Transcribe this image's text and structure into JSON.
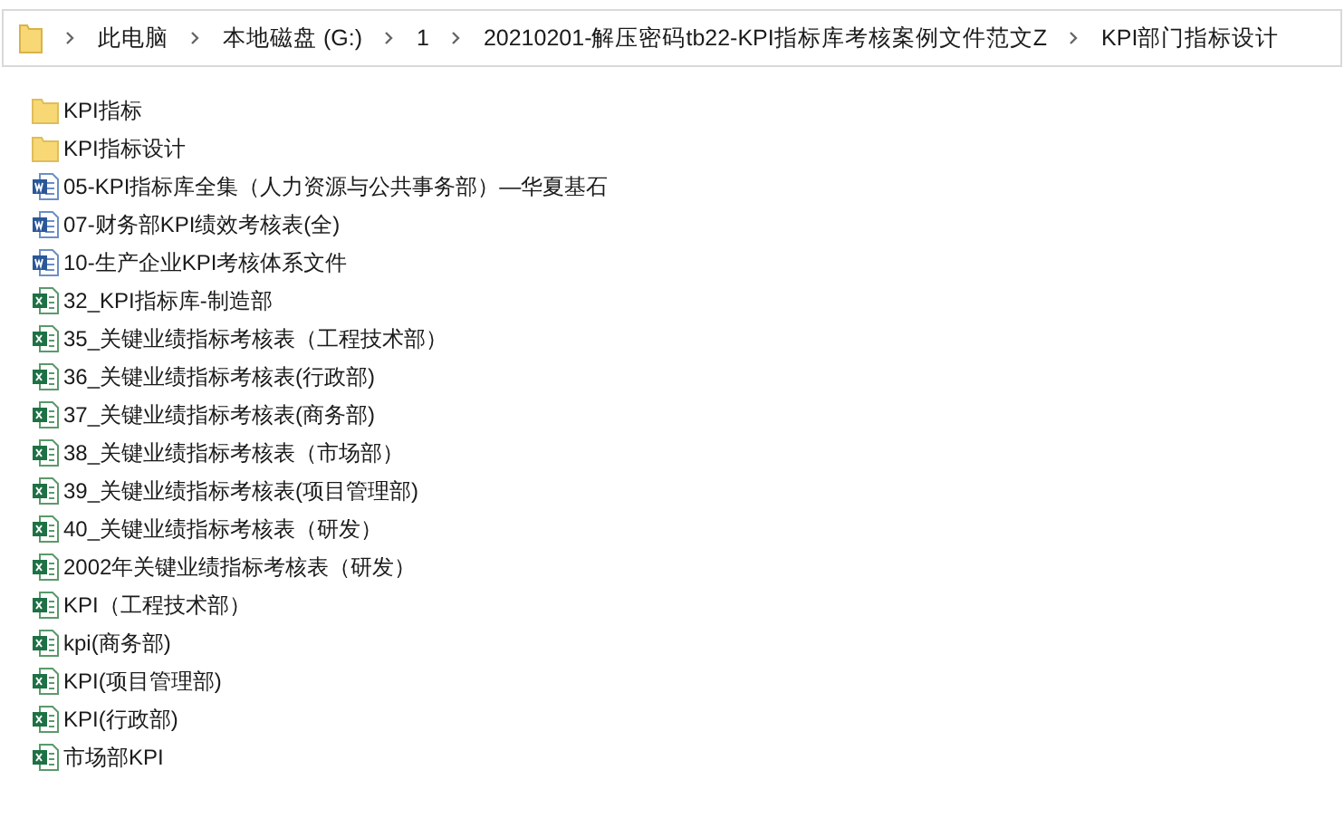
{
  "address_bar": {
    "path": [
      "此电脑",
      "本地磁盘 (G:)",
      "1",
      "20210201-解压密码tb22-KPI指标库考核案例文件范文Z",
      "KPI部门指标设计"
    ]
  },
  "files": [
    {
      "name": "KPI指标",
      "kind": "folder"
    },
    {
      "name": "KPI指标设计",
      "kind": "folder"
    },
    {
      "name": "05-KPI指标库全集（人力资源与公共事务部）—华夏基石",
      "kind": "word"
    },
    {
      "name": "07-财务部KPI绩效考核表(全)",
      "kind": "word"
    },
    {
      "name": "10-生产企业KPI考核体系文件",
      "kind": "word"
    },
    {
      "name": "32_KPI指标库-制造部",
      "kind": "excel"
    },
    {
      "name": "35_关键业绩指标考核表（工程技术部）",
      "kind": "excel"
    },
    {
      "name": "36_关键业绩指标考核表(行政部)",
      "kind": "excel"
    },
    {
      "name": "37_关键业绩指标考核表(商务部)",
      "kind": "excel"
    },
    {
      "name": "38_关键业绩指标考核表（市场部）",
      "kind": "excel"
    },
    {
      "name": "39_关键业绩指标考核表(项目管理部)",
      "kind": "excel"
    },
    {
      "name": "40_关键业绩指标考核表（研发）",
      "kind": "excel"
    },
    {
      "name": "2002年关键业绩指标考核表（研发）",
      "kind": "excel"
    },
    {
      "name": "KPI（工程技术部）",
      "kind": "excel"
    },
    {
      "name": "kpi(商务部)",
      "kind": "excel"
    },
    {
      "name": "KPI(项目管理部)",
      "kind": "excel"
    },
    {
      "name": "KPI(行政部)",
      "kind": "excel"
    },
    {
      "name": "市场部KPI",
      "kind": "excel"
    }
  ]
}
